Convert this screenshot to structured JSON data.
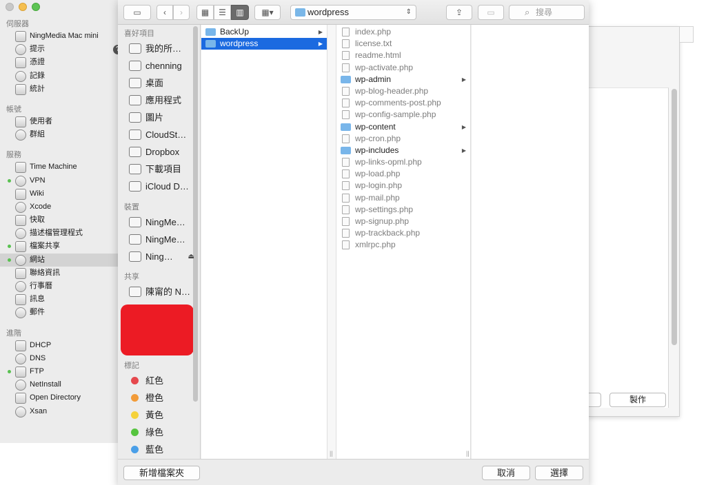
{
  "server_sidebar": {
    "sections": [
      {
        "title": "伺服器",
        "items": [
          {
            "label": "NingMedia Mac mini",
            "icon": "mac-mini-icon",
            "status": false
          },
          {
            "label": "提示",
            "icon": "alerts-icon",
            "status": false,
            "badge": "?"
          },
          {
            "label": "憑證",
            "icon": "certificates-icon",
            "status": false
          },
          {
            "label": "記錄",
            "icon": "logs-icon",
            "status": false
          },
          {
            "label": "統計",
            "icon": "stats-icon",
            "status": false
          }
        ]
      },
      {
        "title": "帳號",
        "items": [
          {
            "label": "使用者",
            "icon": "user-icon",
            "status": false
          },
          {
            "label": "群組",
            "icon": "group-icon",
            "status": false
          }
        ]
      },
      {
        "title": "服務",
        "items": [
          {
            "label": "Time Machine",
            "icon": "time-machine-icon",
            "status": false
          },
          {
            "label": "VPN",
            "icon": "vpn-icon",
            "status": true
          },
          {
            "label": "Wiki",
            "icon": "wiki-icon",
            "status": false
          },
          {
            "label": "Xcode",
            "icon": "xcode-icon",
            "status": false
          },
          {
            "label": "快取",
            "icon": "caching-icon",
            "status": false
          },
          {
            "label": "描述檔管理程式",
            "icon": "profile-manager-icon",
            "status": false
          },
          {
            "label": "檔案共享",
            "icon": "file-sharing-icon",
            "status": true
          },
          {
            "label": "網站",
            "icon": "websites-icon",
            "status": true,
            "selected": true
          },
          {
            "label": "聯絡資訊",
            "icon": "contacts-icon",
            "status": false
          },
          {
            "label": "行事曆",
            "icon": "calendar-icon",
            "status": false
          },
          {
            "label": "訊息",
            "icon": "messages-icon",
            "status": false
          },
          {
            "label": "郵件",
            "icon": "mail-icon",
            "status": false
          }
        ]
      },
      {
        "title": "進階",
        "items": [
          {
            "label": "DHCP",
            "icon": "dhcp-icon",
            "status": false
          },
          {
            "label": "DNS",
            "icon": "dns-icon",
            "status": false
          },
          {
            "label": "FTP",
            "icon": "ftp-icon",
            "status": true
          },
          {
            "label": "NetInstall",
            "icon": "netinstall-icon",
            "status": false
          },
          {
            "label": "Open Directory",
            "icon": "open-directory-icon",
            "status": false
          },
          {
            "label": "Xsan",
            "icon": "xsan-icon",
            "status": false
          }
        ]
      }
    ]
  },
  "background_sheet": {
    "make_button": "製作"
  },
  "dialog": {
    "toolbar": {
      "path_folder": "wordpress",
      "search_placeholder": "搜尋"
    },
    "sidebar": {
      "favorites_title": "喜好項目",
      "favorites": [
        {
          "label": "我的所…",
          "icon": "all-files-icon"
        },
        {
          "label": "chenning",
          "icon": "home-icon"
        },
        {
          "label": "桌面",
          "icon": "desktop-icon"
        },
        {
          "label": "應用程式",
          "icon": "applications-icon"
        },
        {
          "label": "圖片",
          "icon": "pictures-icon"
        },
        {
          "label": "CloudSt…",
          "icon": "folder-icon"
        },
        {
          "label": "Dropbox",
          "icon": "dropbox-icon"
        },
        {
          "label": "下載項目",
          "icon": "downloads-icon"
        },
        {
          "label": "iCloud D…",
          "icon": "icloud-icon"
        }
      ],
      "devices_title": "裝置",
      "devices": [
        {
          "label": "NingMe…",
          "icon": "computer-icon"
        },
        {
          "label": "NingMe…",
          "icon": "disk-icon"
        },
        {
          "label": "Ning…",
          "icon": "disk-icon",
          "eject": true
        }
      ],
      "shared_title": "共享",
      "shared": [
        {
          "label": "陳甯的 N…",
          "icon": "shared-computer-icon"
        }
      ],
      "tags_title": "標記",
      "tags": [
        {
          "label": "紅色",
          "color": "#e5484d"
        },
        {
          "label": "橙色",
          "color": "#f29b38"
        },
        {
          "label": "黃色",
          "color": "#f5d23b"
        },
        {
          "label": "綠色",
          "color": "#56c43f"
        },
        {
          "label": "藍色",
          "color": "#4a9fe8"
        }
      ]
    },
    "column1": [
      {
        "label": "BackUp",
        "type": "folder",
        "selected": false
      },
      {
        "label": "wordpress",
        "type": "folder",
        "selected": true
      }
    ],
    "column2": [
      {
        "label": "index.php",
        "type": "file"
      },
      {
        "label": "license.txt",
        "type": "file"
      },
      {
        "label": "readme.html",
        "type": "file"
      },
      {
        "label": "wp-activate.php",
        "type": "file"
      },
      {
        "label": "wp-admin",
        "type": "folder"
      },
      {
        "label": "wp-blog-header.php",
        "type": "file"
      },
      {
        "label": "wp-comments-post.php",
        "type": "file"
      },
      {
        "label": "wp-config-sample.php",
        "type": "file"
      },
      {
        "label": "wp-content",
        "type": "folder"
      },
      {
        "label": "wp-cron.php",
        "type": "file"
      },
      {
        "label": "wp-includes",
        "type": "folder"
      },
      {
        "label": "wp-links-opml.php",
        "type": "file"
      },
      {
        "label": "wp-load.php",
        "type": "file"
      },
      {
        "label": "wp-login.php",
        "type": "file"
      },
      {
        "label": "wp-mail.php",
        "type": "file"
      },
      {
        "label": "wp-settings.php",
        "type": "file"
      },
      {
        "label": "wp-signup.php",
        "type": "file"
      },
      {
        "label": "wp-trackback.php",
        "type": "file"
      },
      {
        "label": "xmlrpc.php",
        "type": "file"
      }
    ],
    "bottom": {
      "new_folder": "新增檔案夾",
      "cancel": "取消",
      "choose": "選擇"
    }
  }
}
